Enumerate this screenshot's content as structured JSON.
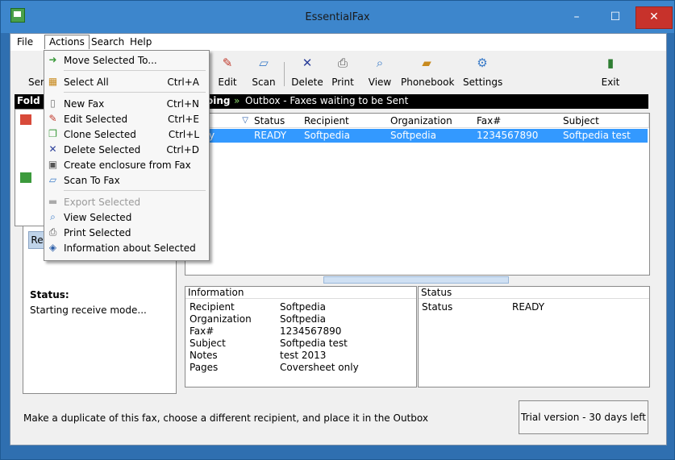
{
  "window": {
    "title": "EssentialFax",
    "min": "–",
    "max": "☐",
    "close": "✕"
  },
  "menubar": {
    "file": "File",
    "actions": "Actions",
    "search": "Search",
    "help": "Help"
  },
  "toolbar": {
    "send": "Ser",
    "edit": "Edit",
    "scan": "Scan",
    "delete": "Delete",
    "print": "Print",
    "view": "View",
    "phonebook": "Phonebook",
    "settings": "Settings",
    "exit": "Exit"
  },
  "darkbar": {
    "left": "Fold",
    "mid": "oing",
    "outbox": "Outbox - Faxes waiting to be Sent"
  },
  "statuspanel": {
    "tab": "Re",
    "label": "Status:",
    "value": "Starting receive mode..."
  },
  "list": {
    "headers": [
      "fied",
      "Status",
      "Recipient",
      "Organization",
      "Fax#",
      "Subject"
    ],
    "row": [
      "y",
      "READY",
      "Softpedia",
      "Softpedia",
      "1234567890",
      "Softpedia test"
    ]
  },
  "info": {
    "header": "Information",
    "rows": [
      {
        "k": "Recipient",
        "v": "Softpedia"
      },
      {
        "k": "Organization",
        "v": "Softpedia"
      },
      {
        "k": "Fax#",
        "v": "1234567890"
      },
      {
        "k": "Subject",
        "v": "Softpedia test"
      },
      {
        "k": "Notes",
        "v": "test 2013"
      },
      {
        "k": "Pages",
        "v": "Coversheet only"
      }
    ]
  },
  "statusinfo": {
    "header": "Status",
    "k": "Status",
    "v": "READY"
  },
  "bottom": {
    "message": "Make a duplicate of this fax, choose a different recipient, and place it in the Outbox",
    "trial": "Trial version - 30 days left"
  },
  "actions_menu": [
    {
      "label": "Move Selected To...",
      "shortcut": "",
      "icon": "folder-arrow-icon"
    },
    {
      "label": "Select All",
      "shortcut": "Ctrl+A",
      "icon": "grid-icon"
    },
    {
      "label": "New Fax",
      "shortcut": "Ctrl+N",
      "icon": "document-icon"
    },
    {
      "label": "Edit Selected",
      "shortcut": "Ctrl+E",
      "icon": "pencil-icon"
    },
    {
      "label": "Clone Selected",
      "shortcut": "Ctrl+L",
      "icon": "clone-icon"
    },
    {
      "label": "Delete Selected",
      "shortcut": "Ctrl+D",
      "icon": "delete-x-icon"
    },
    {
      "label": "Create enclosure from Fax",
      "shortcut": "",
      "icon": "enclosure-icon"
    },
    {
      "label": "Scan To Fax",
      "shortcut": "",
      "icon": "scanner-icon"
    },
    {
      "label": "Export Selected",
      "shortcut": "",
      "icon": "export-icon"
    },
    {
      "label": "View Selected",
      "shortcut": "",
      "icon": "magnifier-icon"
    },
    {
      "label": "Print Selected",
      "shortcut": "",
      "icon": "printer-icon"
    },
    {
      "label": "Information about Selected",
      "shortcut": "",
      "icon": "info-diamond-icon"
    }
  ]
}
